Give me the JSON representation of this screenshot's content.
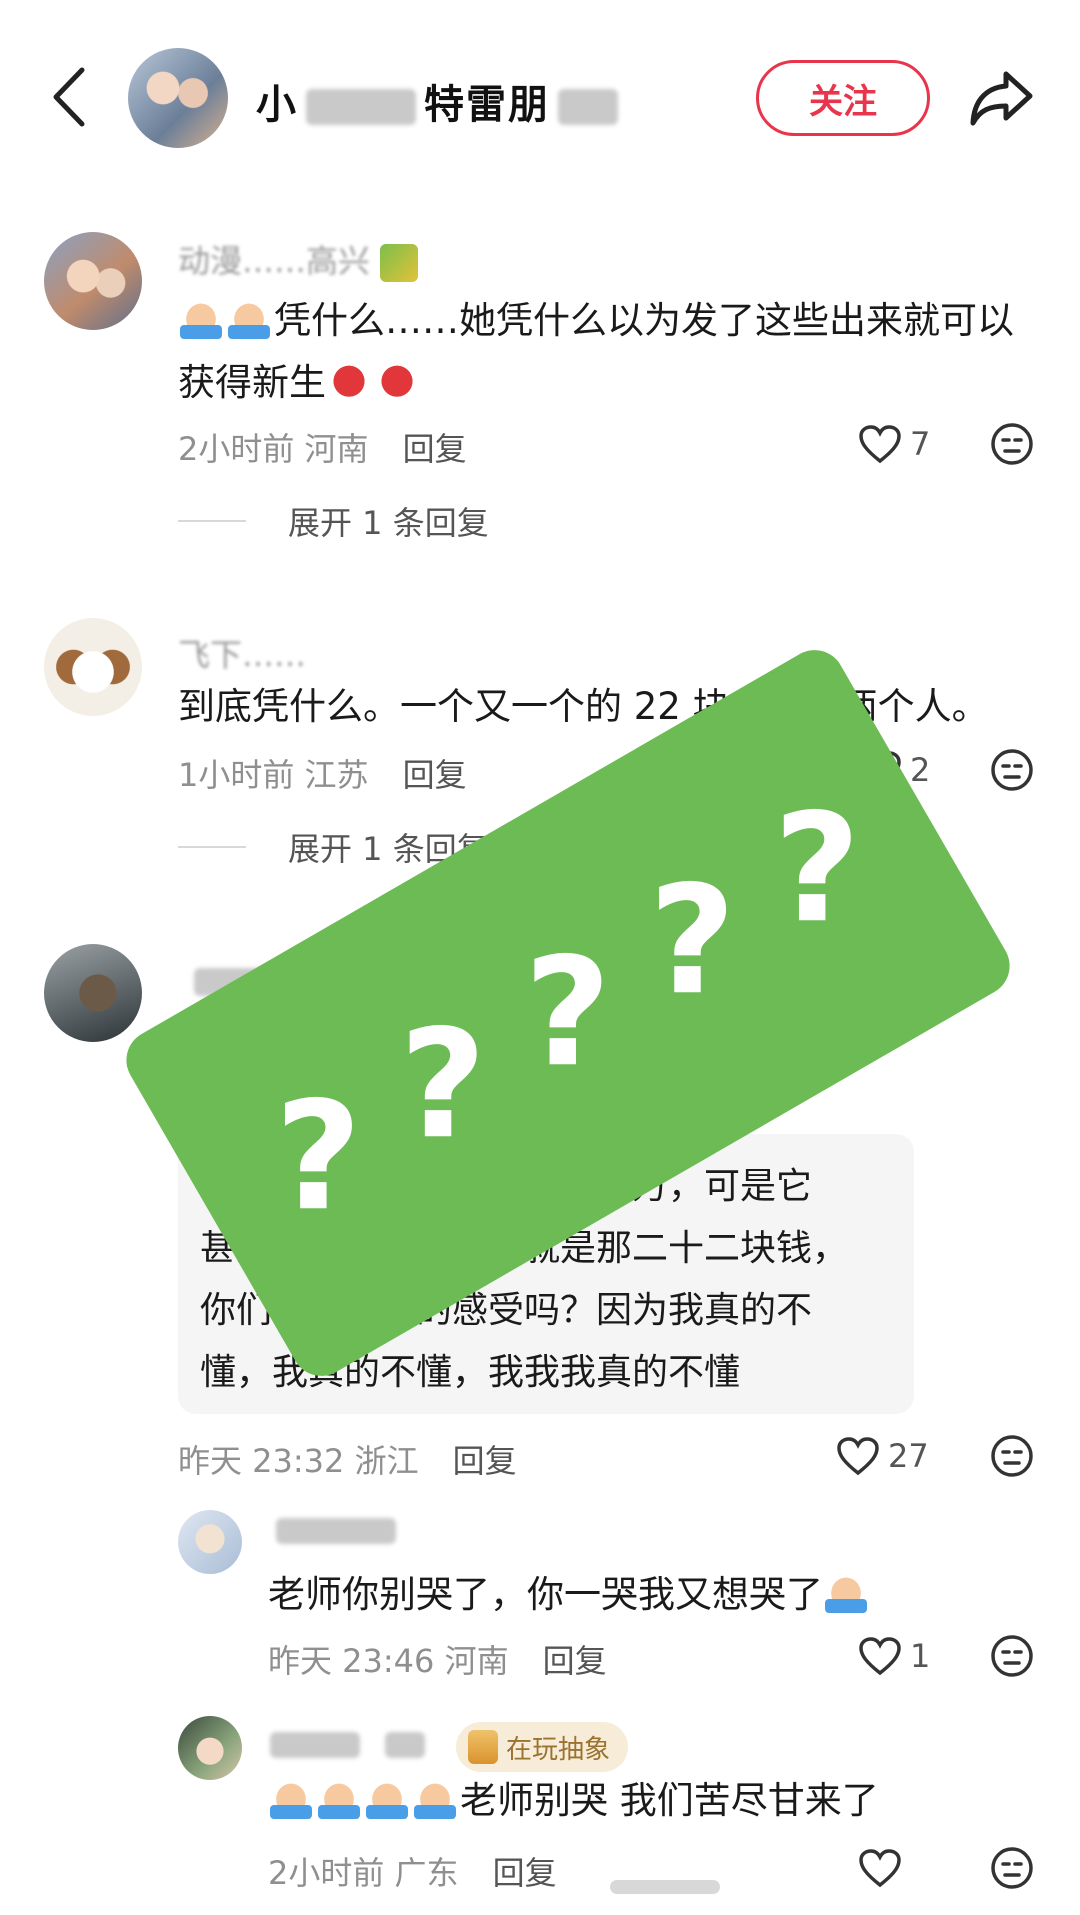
{
  "header": {
    "title_visible_1": "小",
    "title_visible_2": "特雷朋",
    "follow_label": "关注"
  },
  "comments": [
    {
      "username": "动漫……高兴",
      "text": "凭什么……她凭什么以为发了这些出来就可以获得新生",
      "time": "2小时前",
      "location": "河南",
      "reply_label": "回复",
      "likes": "7",
      "expand_label": "展开 1 条回复"
    },
    {
      "username": "飞下……",
      "text": "到底凭什么。一个又一个的 22 块……了两个人。",
      "time": "1小时前",
      "location": "江苏",
      "reply_label": "回复",
      "likes": "2",
      "expand_label": "展开 1 条回复"
    },
    {
      "quote_lines": [
        "它可以是千万，它可以是两万，可是它",
        "甚至都不是两百，它就是那二十二块钱，",
        "你们能理解我的感受吗？因为我真的不",
        "懂，我真的不懂，我我我真的不懂"
      ],
      "time": "昨天 23:32",
      "location": "浙江",
      "reply_label": "回复",
      "likes": "27"
    },
    {
      "text": "老师你别哭了，你一哭我又想哭了",
      "time": "昨天 23:46",
      "location": "河南",
      "reply_label": "回复",
      "likes": "1"
    },
    {
      "badge": "在玩抽象",
      "text": "老师别哭 我们苦尽甘来了",
      "time": "2小时前",
      "location": "广东",
      "reply_label": "回复"
    }
  ],
  "overlay": {
    "marks": [
      "?",
      "?",
      "?",
      "?",
      "?"
    ],
    "color": "#6dbb55"
  },
  "colors": {
    "accent": "#e8354b"
  }
}
